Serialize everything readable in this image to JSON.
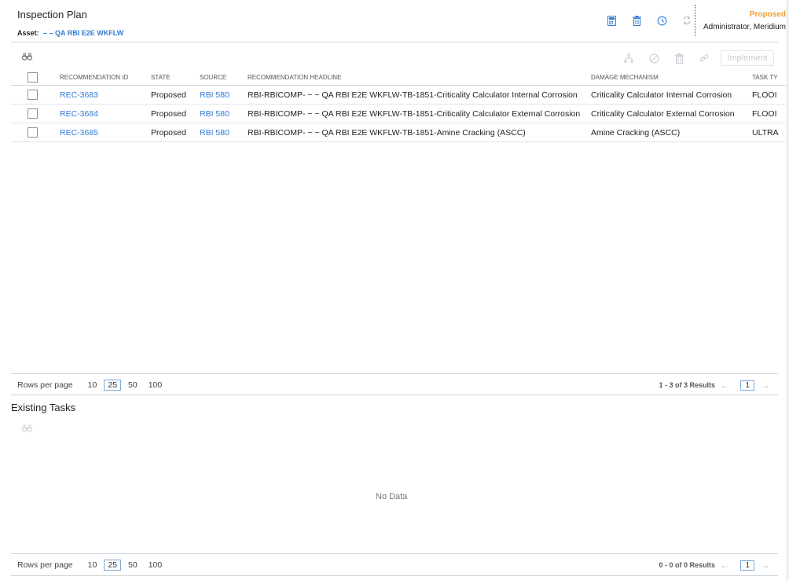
{
  "header": {
    "title": "Inspection Plan",
    "asset_label": "Asset:",
    "asset_value": "– – QA RBI E2E WKFLW",
    "state": "Proposed",
    "user": "Administrator, Meridium",
    "icons": [
      "calculator-icon",
      "delete-icon",
      "history-icon",
      "refresh-icon"
    ],
    "state_color": "#f0a030"
  },
  "recommendations": {
    "toolbar": {
      "find_icon": "binoculars-icon",
      "tools": [
        "hierarchy-icon",
        "cancel-icon",
        "delete-icon",
        "link-icon"
      ],
      "implement_label": "Implement"
    },
    "columns": [
      "RECOMMENDATION ID",
      "STATE",
      "SOURCE",
      "RECOMMENDATION HEADLINE",
      "DAMAGE MECHANISM",
      "TASK TY"
    ],
    "rows": [
      [
        "REC-3683",
        "Proposed",
        "RBI 580",
        "RBI-RBICOMP- ~ ~ QA RBI E2E WKFLW-TB-1851-Criticality Calculator Internal Corrosion",
        "Criticality Calculator Internal Corrosion",
        "FLOOI"
      ],
      [
        "REC-3684",
        "Proposed",
        "RBI 580",
        "RBI-RBICOMP- ~ ~ QA RBI E2E WKFLW-TB-1851-Criticality Calculator External Corrosion",
        "Criticality Calculator External Corrosion",
        "FLOOI"
      ],
      [
        "REC-3685",
        "Proposed",
        "RBI 580",
        "RBI-RBICOMP- ~ ~ QA RBI E2E WKFLW-TB-1851-Amine Cracking (ASCC)",
        "Amine Cracking (ASCC)",
        "ULTRA"
      ]
    ],
    "pager": {
      "rows_per_page_label": "Rows per page",
      "options": [
        "10",
        "25",
        "50",
        "100"
      ],
      "selected": "25",
      "results": "1 - 3 of 3 Results",
      "page": "1"
    }
  },
  "existing_tasks": {
    "title": "Existing Tasks",
    "find_icon": "binoculars-icon",
    "empty_text": "No Data",
    "pager": {
      "rows_per_page_label": "Rows per page",
      "options": [
        "10",
        "25",
        "50",
        "100"
      ],
      "selected": "25",
      "results": "0 - 0 of 0 Results",
      "page": "1"
    }
  },
  "colors": {
    "link": "#2f7bd6",
    "accent": "#f0a030"
  }
}
